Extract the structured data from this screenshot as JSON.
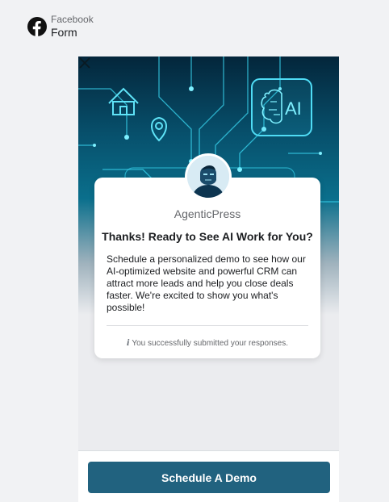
{
  "header": {
    "subtitle": "Facebook",
    "title": "Form",
    "icon": "facebook-icon"
  },
  "hero": {
    "icons": [
      "home-icon",
      "location-pin-icon",
      "ai-brain-icon"
    ],
    "ai_text": "AI",
    "close_icon": "close-icon"
  },
  "card": {
    "brand": "AgenticPress",
    "headline": "Thanks! Ready to See AI Work for You?",
    "body": "Schedule a personalized demo to see how our AI-optimized website and powerful CRM can attract more leads and help you close deals faster. We're excited to show you what's possible!",
    "confirmation": "You successfully submitted your responses.",
    "confirmation_icon": "info-icon"
  },
  "footer": {
    "cta_label": "Schedule A Demo"
  },
  "colors": {
    "cta": "#21627f",
    "hero_dark": "#04263b",
    "hero_glow": "#2ee6ff"
  }
}
